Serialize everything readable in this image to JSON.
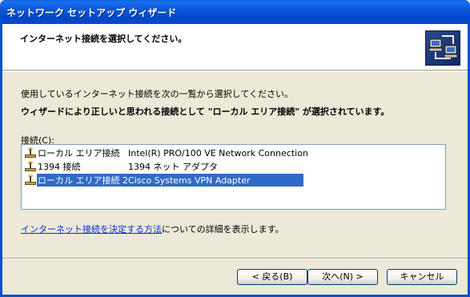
{
  "window": {
    "title": "ネットワーク セットアップ ウィザード"
  },
  "header": {
    "heading": "インターネット接続を選択してください。",
    "icon": "network-wizard-icon"
  },
  "body": {
    "intro": "使用しているインターネット接続を次の一覧から選択してください。",
    "note": "ウィザードにより正しいと思われる接続として \"ローカル エリア接続\" が選択されています。",
    "list_label": "接続(C):",
    "connections": [
      {
        "name": "ローカル エリア接続",
        "device": "Intel(R) PRO/100 VE Network Connection",
        "selected": false
      },
      {
        "name": "1394 接続",
        "device": "1394 ネット アダプタ",
        "selected": false
      },
      {
        "name": "ローカル エリア接続 2",
        "device": "Cisco Systems VPN Adapter",
        "selected": true
      }
    ],
    "link_text": "インターネット接続を決定する方法",
    "link_suffix": "についての詳細を表示します。"
  },
  "buttons": {
    "back": "< 戻る(B)",
    "next": "次へ(N) >",
    "cancel": "キャンセル"
  },
  "colors": {
    "title_bar": "#0b57d6",
    "selection": "#316ac5",
    "link": "#0033cc"
  }
}
